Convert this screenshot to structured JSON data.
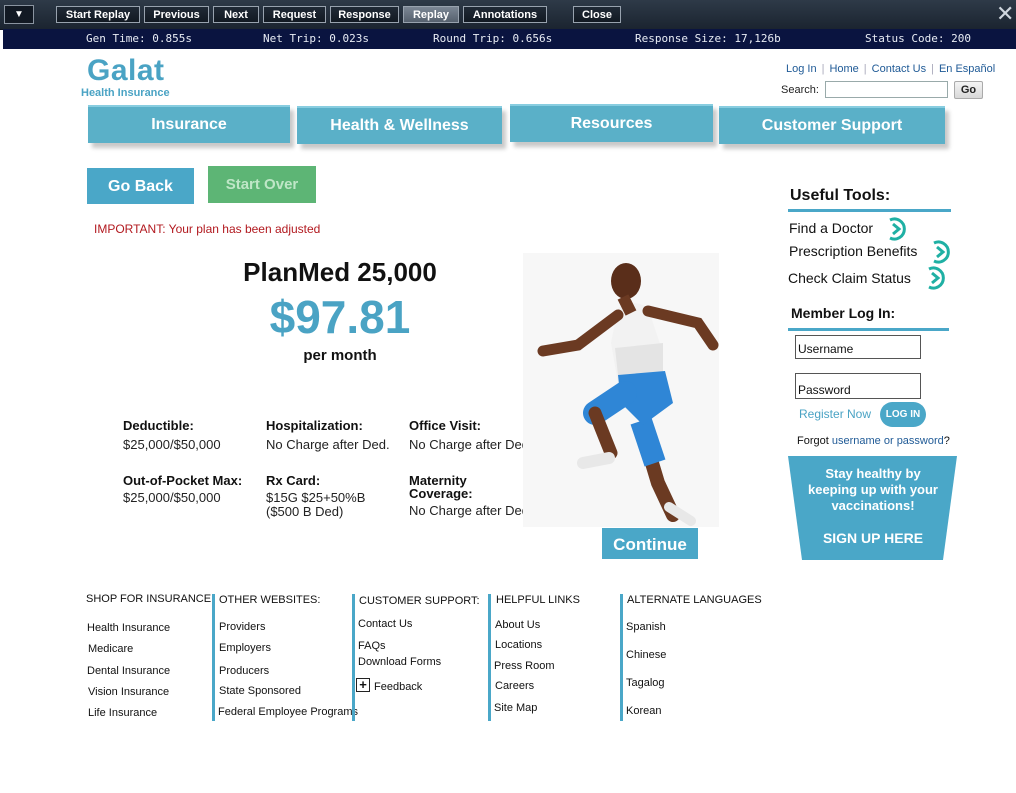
{
  "toolbar": {
    "menu_icon": "caret-down-icon",
    "buttons": [
      "Start Replay",
      "Previous",
      "Next",
      "Request",
      "Response",
      "Replay",
      "Annotations"
    ],
    "close_label": "Close",
    "close_icon": "close-x-icon",
    "active_button": "Replay"
  },
  "stats": {
    "gen_time": "Gen Time: 0.855s",
    "net_trip": "Net Trip: 0.023s",
    "round_trip": "Round Trip: 0.656s",
    "response_size": "Response Size: 17,126b",
    "status_code": "Status Code: 200"
  },
  "header": {
    "logo_name": "Galat",
    "logo_sub": "Health Insurance",
    "links": [
      "Log In",
      "Home",
      "Contact Us",
      "En Español"
    ],
    "search_label": "Search:",
    "search_value": "",
    "search_go": "Go"
  },
  "nav": [
    "Insurance",
    "Health & Wellness",
    "Resources",
    "Customer Support"
  ],
  "actions": {
    "go_back": "Go Back",
    "start_over": "Start Over"
  },
  "notice": "IMPORTANT: Your plan has been adjusted",
  "plan": {
    "name": "PlanMed 25,000",
    "price": "$97.81",
    "period": "per month",
    "details": [
      {
        "label": "Deductible:",
        "value": "$25,000/$50,000"
      },
      {
        "label": "Hospitalization:",
        "value": "No Charge after Ded."
      },
      {
        "label": "Office Visit:",
        "value": "No Charge after Ded."
      },
      {
        "label": "Out-of-Pocket Max:",
        "value": "$25,000/$50,000"
      },
      {
        "label": "Rx Card:",
        "value": "$15G $25+50%B ($500 B Ded)"
      },
      {
        "label": "Maternity Coverage:",
        "value": "No Charge after Ded."
      }
    ],
    "continue": "Continue"
  },
  "useful_tools": {
    "title": "Useful Tools:",
    "items": [
      "Find a Doctor",
      "Prescription Benefits",
      "Check Claim Status"
    ]
  },
  "member_login": {
    "title": "Member Log In:",
    "username_placeholder": "Username",
    "password_placeholder": "Password",
    "register": "Register Now",
    "login_button": "LOG IN",
    "forgot_prefix": "Forgot",
    "forgot_username": "username",
    "forgot_or": "or",
    "forgot_password": "password",
    "forgot_suffix": "?"
  },
  "promo": {
    "text": "Stay healthy by keeping up with your vaccinations!",
    "cta": "SIGN UP HERE"
  },
  "colors": {
    "brand_blue": "#4aa7c8",
    "start_over_green": "#5db575",
    "warning_red": "#b2191f",
    "toolbar_dark": "#1b2430",
    "stats_navy": "#0a1440"
  },
  "footer": {
    "shop": {
      "heading": "SHOP FOR INSURANCE:",
      "items": [
        "Health Insurance",
        "Medicare",
        "Dental Insurance",
        "Vision Insurance",
        "Life Insurance"
      ]
    },
    "other": {
      "heading": "OTHER WEBSITES:",
      "items": [
        "Providers",
        "Employers",
        "Producers",
        "State Sponsored",
        "Federal Employee Programs"
      ]
    },
    "support": {
      "heading": "CUSTOMER SUPPORT:",
      "items": [
        "Contact Us",
        "FAQs",
        "Download Forms",
        "Feedback"
      ]
    },
    "helpful": {
      "heading": "HELPFUL LINKS",
      "items": [
        "About Us",
        "Locations",
        "Press Room",
        "Careers",
        "Site Map"
      ]
    },
    "languages": {
      "heading": "ALTERNATE LANGUAGES",
      "items": [
        "Spanish",
        "Chinese",
        "Tagalog",
        "Korean"
      ]
    }
  }
}
